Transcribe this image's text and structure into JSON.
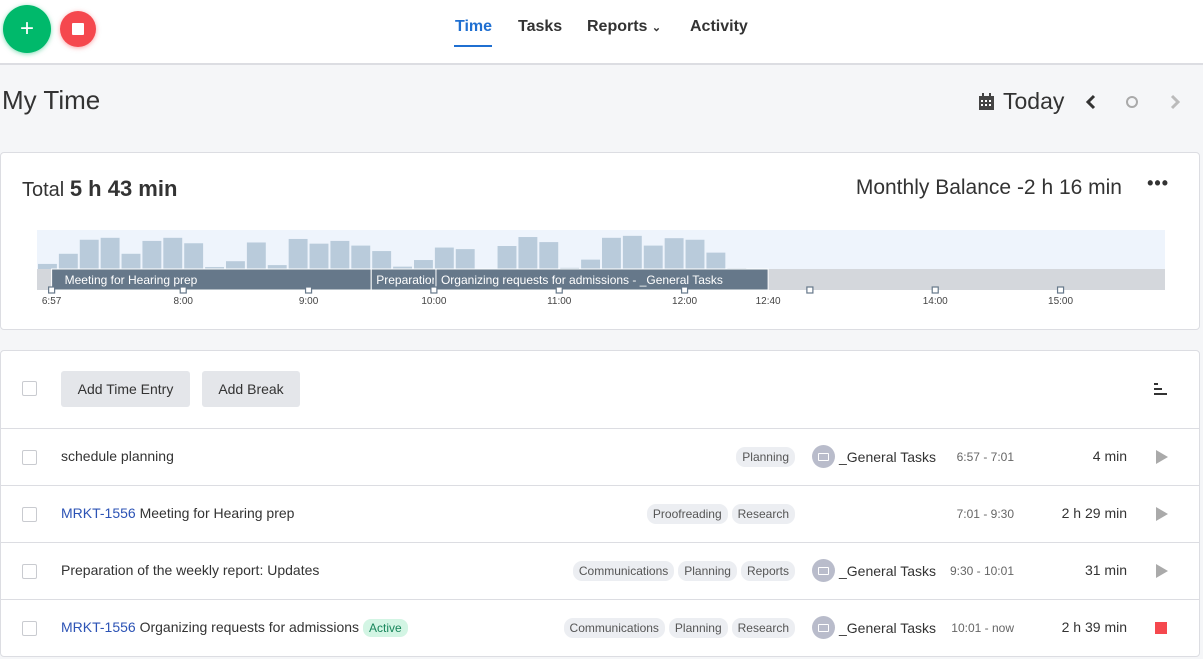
{
  "nav": {
    "items": [
      {
        "label": "Time",
        "active": true
      },
      {
        "label": "Tasks"
      },
      {
        "label": "Reports",
        "dropdown": true
      },
      {
        "label": "Activity"
      }
    ],
    "add_icon": "plus-icon",
    "stop_icon": "stop-icon"
  },
  "page": {
    "title": "My Time",
    "date_label": "Today"
  },
  "summary": {
    "total_label": "Total",
    "total_value": "5 h 43 min",
    "balance_label": "Monthly Balance",
    "balance_value": "-2 h 16 min",
    "more": "•••"
  },
  "chart_data": {
    "type": "bar",
    "x_range": [
      "6:50",
      "15:50"
    ],
    "bin_minutes": 10,
    "bins_start": "6:50",
    "activity_levels": [
      0.13,
      0.39,
      0.75,
      0.8,
      0.39,
      0.72,
      0.8,
      0.66,
      0.05,
      0.2,
      0.68,
      0.1,
      0.77,
      0.65,
      0.72,
      0.6,
      0.46,
      0.06,
      0.23,
      0.55,
      0.51,
      0,
      0.59,
      0.82,
      0.69,
      0.03,
      0.24,
      0.8,
      0.85,
      0.6,
      0.79,
      0.75,
      0.42,
      0.02
    ],
    "segments": [
      {
        "start": "6:57",
        "end": "9:30",
        "label": "Meeting for Hearing prep"
      },
      {
        "start": "9:30",
        "end": "10:01",
        "label": "Preparation of the weekly report: Updates"
      },
      {
        "start": "10:01",
        "end": "12:40",
        "label": "Organizing requests for admissions - _General Tasks"
      }
    ],
    "ticks": [
      {
        "t": "6:57",
        "label": "6:57"
      },
      {
        "t": "8:00",
        "label": "8:00"
      },
      {
        "t": "9:00",
        "label": "9:00"
      },
      {
        "t": "10:00",
        "label": "10:00"
      },
      {
        "t": "11:00",
        "label": "11:00"
      },
      {
        "t": "12:00",
        "label": "12:00"
      },
      {
        "t": "12:40",
        "label": "12:40",
        "marker": false
      },
      {
        "t": "13:00",
        "label": ""
      },
      {
        "t": "14:00",
        "label": "14:00"
      },
      {
        "t": "15:00",
        "label": "15:00"
      }
    ],
    "colors": {
      "bar": "#b9cbdb",
      "bar_bg": "#eef4fc",
      "segment": "#66788a",
      "track": "#d4d7dc"
    }
  },
  "toolbar": {
    "add_entry": "Add Time Entry",
    "add_break": "Add Break",
    "sort_icon": "sort-icon"
  },
  "entries": [
    {
      "key": "",
      "title": "schedule planning",
      "active": false,
      "tags": [
        "Planning"
      ],
      "project": "_General Tasks",
      "range": "6:57 - 7:01",
      "duration": "4 min",
      "action": "play"
    },
    {
      "key": "MRKT-1556",
      "title": "Meeting for Hearing prep",
      "active": false,
      "tags": [
        "Proofreading",
        "Research"
      ],
      "project": "",
      "range": "7:01 - 9:30",
      "duration": "2 h 29 min",
      "action": "play"
    },
    {
      "key": "",
      "title": "Preparation of the weekly report: Updates",
      "active": false,
      "tags": [
        "Communications",
        "Planning",
        "Reports"
      ],
      "project": "_General Tasks",
      "range": "9:30 - 10:01",
      "duration": "31 min",
      "action": "play"
    },
    {
      "key": "MRKT-1556",
      "title": "Organizing requests for admissions",
      "active": true,
      "badge": "Active",
      "tags": [
        "Communications",
        "Planning",
        "Research"
      ],
      "project": "_General Tasks",
      "range": "10:01 - now",
      "duration": "2 h 39 min",
      "action": "stop"
    }
  ]
}
